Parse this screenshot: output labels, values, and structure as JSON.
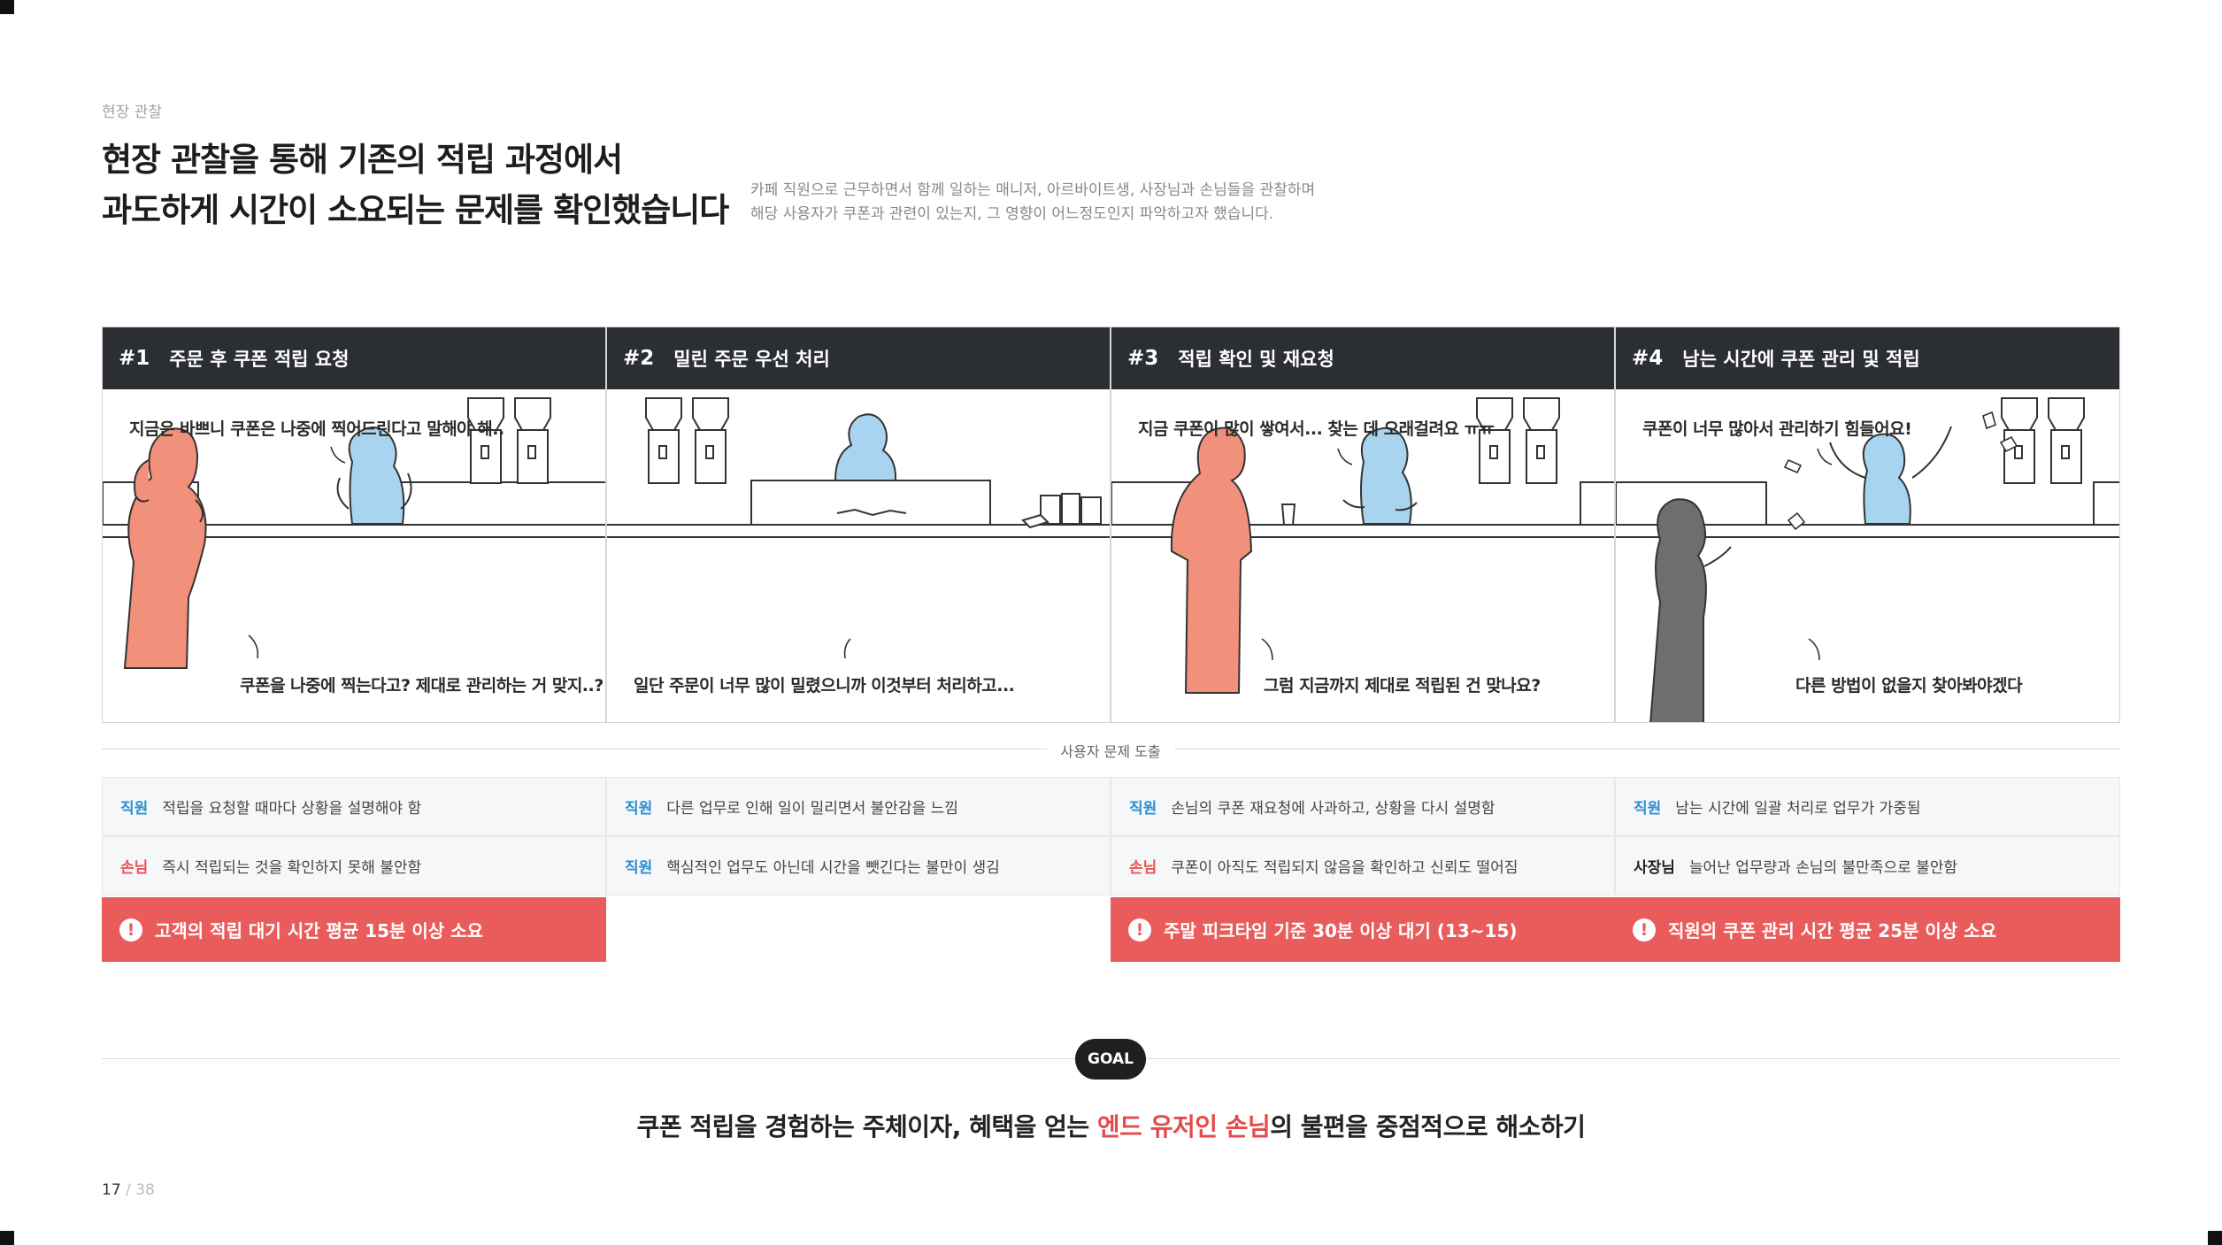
{
  "section_label": "현장 관찰",
  "headline": {
    "line1": "현장 관찰을 통해 기존의 적립 과정에서",
    "line2": "과도하게 시간이 소요되는 문제를 확인했습니다"
  },
  "description": {
    "line1": "카페 직원으로 근무하면서 함께 일하는 매니저, 아르바이트생, 사장님과 손님들을 관찰하며",
    "line2": "해당 사용자가 쿠폰과 관련이 있는지, 그 영향이 어느정도인지 파악하고자 했습니다."
  },
  "panels": [
    {
      "num": "#1",
      "title": "주문 후 쿠폰 적립 요청",
      "bubble_top": "지금은 바쁘니 쿠폰은 나중에 찍어드린다고 말해야 해..",
      "bubble_bottom": "쿠폰을 나중에 찍는다고? 제대로 관리하는 거 맞지..?"
    },
    {
      "num": "#2",
      "title": "밀린 주문 우선 처리",
      "bubble_top": "",
      "bubble_bottom": "일단 주문이 너무 많이 밀렸으니까 이것부터 처리하고..."
    },
    {
      "num": "#3",
      "title": "적립 확인 및 재요청",
      "bubble_top": "지금 쿠폰이 많이 쌓여서... 찾는 데 오래걸려요 ㅠㅠ",
      "bubble_bottom": "그럼 지금까지 제대로 적립된 건 맞나요?"
    },
    {
      "num": "#4",
      "title": "남는 시간에 쿠폰 관리 및 적립",
      "bubble_top": "쿠폰이 너무 많아서 관리하기 힘들어요!",
      "bubble_bottom": "다른 방법이 없을지 찾아봐야겠다"
    }
  ],
  "colors": {
    "customer": "#f2917b",
    "staff": "#a8d4f0",
    "owner": "#6e6e6e",
    "header_bg": "#2b2e33",
    "alert": "#ea5c5c"
  },
  "divider_label": "사용자 문제 도출",
  "issues": [
    [
      {
        "role": "직원",
        "type": "staff",
        "text": "적립을 요청할 때마다 상황을 설명해야 함"
      },
      {
        "role": "손님",
        "type": "customer",
        "text": "즉시 적립되는 것을 확인하지 못해 불안함"
      }
    ],
    [
      {
        "role": "직원",
        "type": "staff",
        "text": "다른 업무로 인해 일이 밀리면서 불안감을 느낌"
      },
      {
        "role": "직원",
        "type": "staff",
        "text": "핵심적인 업무도 아닌데 시간을 뺏긴다는 불만이 생김"
      }
    ],
    [
      {
        "role": "직원",
        "type": "staff",
        "text": "손님의 쿠폰 재요청에 사과하고, 상황을 다시 설명함"
      },
      {
        "role": "손님",
        "type": "customer",
        "text": "쿠폰이 아직도 적립되지 않음을 확인하고 신뢰도 떨어짐"
      }
    ],
    [
      {
        "role": "직원",
        "type": "staff",
        "text": "남는 시간에 일괄 처리로 업무가 가중됨"
      },
      {
        "role": "사장님",
        "type": "owner",
        "text": "늘어난 업무량과 손님의 불만족으로 불안함"
      }
    ]
  ],
  "alerts": [
    {
      "col": 0,
      "text": "고객의 적립 대기 시간 평균 15분 이상 소요"
    },
    {
      "col": 2,
      "text": "주말 피크타임 기준 30분 이상 대기 (13~15)"
    },
    {
      "col": 3,
      "text": "직원의 쿠폰 관리 시간 평균 25분 이상 소요"
    }
  ],
  "alert_icon": "!",
  "goal": {
    "badge": "GOAL",
    "text_before": "쿠폰 적립을 경험하는 주체이자, 혜택을 얻는 ",
    "text_highlight": "엔드 유저인 손님",
    "text_after": "의 불편을 중점적으로 해소하기"
  },
  "page": {
    "current": "17",
    "separator": " / ",
    "total": "38"
  }
}
